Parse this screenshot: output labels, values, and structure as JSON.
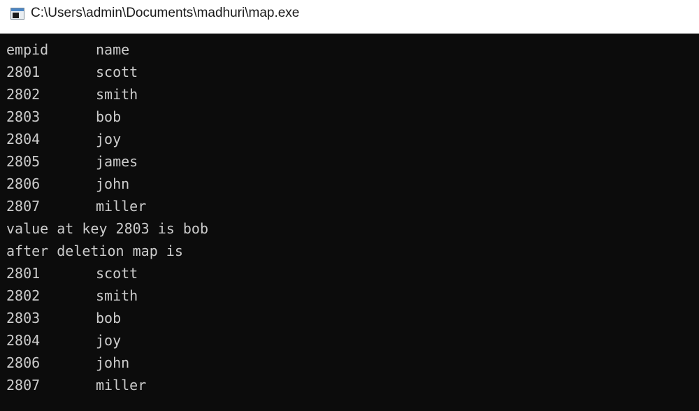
{
  "window": {
    "title": "C:\\Users\\admin\\Documents\\madhuri\\map.exe",
    "icon": "console-app-icon"
  },
  "console": {
    "header": {
      "col1": "empid",
      "col2": "name"
    },
    "map_rows": [
      {
        "id": "2801",
        "name": "scott"
      },
      {
        "id": "2802",
        "name": "smith"
      },
      {
        "id": "2803",
        "name": "bob"
      },
      {
        "id": "2804",
        "name": "joy"
      },
      {
        "id": "2805",
        "name": "james"
      },
      {
        "id": "2806",
        "name": "john"
      },
      {
        "id": "2807",
        "name": "miller"
      }
    ],
    "value_message": "value at key 2803 is bob",
    "deletion_message": "after deletion map is",
    "after_rows": [
      {
        "id": "2801",
        "name": "scott"
      },
      {
        "id": "2802",
        "name": "smith"
      },
      {
        "id": "2803",
        "name": "bob"
      },
      {
        "id": "2804",
        "name": "joy"
      },
      {
        "id": "2806",
        "name": "john"
      },
      {
        "id": "2807",
        "name": "miller"
      }
    ]
  }
}
